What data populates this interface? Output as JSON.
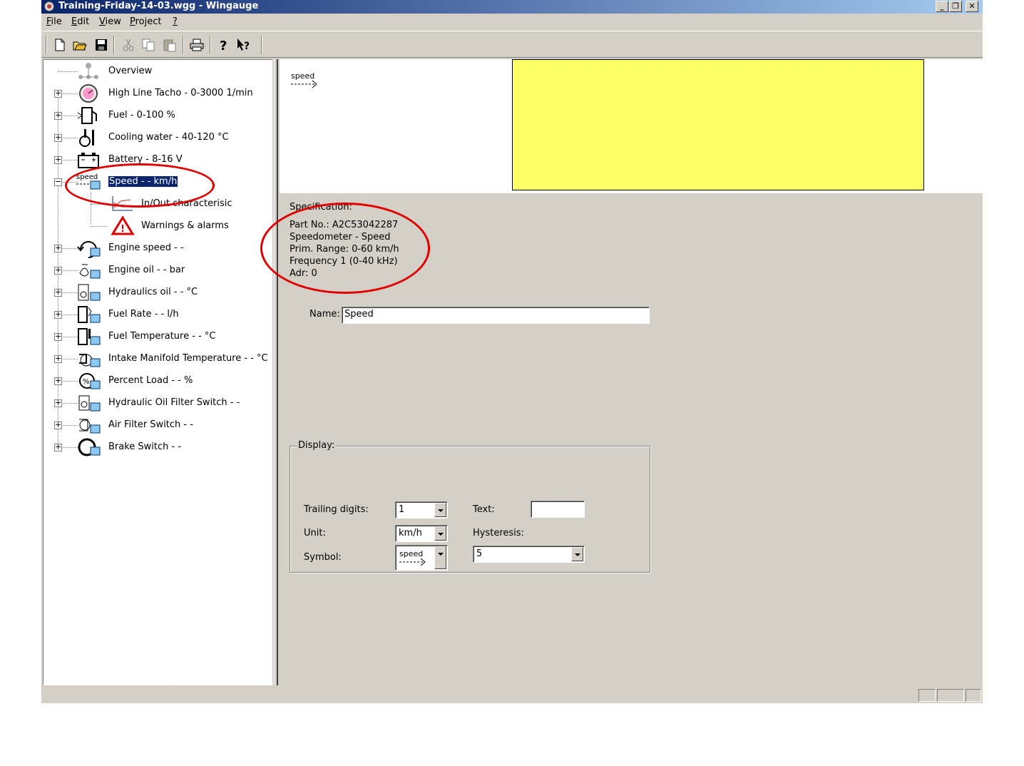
{
  "window": {
    "title": "Training-Friday-14-03.wgg - Wingauge",
    "controls": [
      "_",
      "ʘ",
      "X"
    ]
  },
  "menu": [
    {
      "label": "File"
    },
    {
      "label": "Edit"
    },
    {
      "label": "View"
    },
    {
      "label": "Project"
    },
    {
      "label": "?"
    }
  ],
  "toolbar": {
    "icons": [
      "new-icon",
      "open-icon",
      "save-icon",
      "cut-icon",
      "copy-icon",
      "paste-icon",
      "print-icon",
      "help-icon",
      "context-help-icon"
    ]
  },
  "tree": {
    "items": [
      {
        "label": "Overview",
        "icon": "overview-icon"
      },
      {
        "label": "High Line Tacho - 0-3000 1/min",
        "icon": "tacho-icon"
      },
      {
        "label": "Fuel - 0-100 %",
        "icon": "fuel-icon"
      },
      {
        "label": "Cooling water - 40-120 °C",
        "icon": "thermometer-icon"
      },
      {
        "label": "Battery - 8-16 V",
        "icon": "battery-icon"
      },
      {
        "label": "Speed - - km/h",
        "icon": "speed-icon",
        "selected": true
      },
      {
        "label": "In/Out characterisic",
        "icon": "chart-icon"
      },
      {
        "label": "Warnings & alarms",
        "icon": "warning-icon"
      },
      {
        "label": "Engine speed - -",
        "icon": "engine-speed-icon"
      },
      {
        "label": "Engine oil - - bar",
        "icon": "oil-can-icon"
      },
      {
        "label": "Hydraulics oil - - °C",
        "icon": "hydraulic-oil-icon"
      },
      {
        "label": "Fuel Rate - - l/h",
        "icon": "fuel-rate-icon"
      },
      {
        "label": "Fuel Temperature - - °C",
        "icon": "fuel-temp-icon"
      },
      {
        "label": "Intake Manifold Temperature - - °C",
        "icon": "intake-manifold-icon"
      },
      {
        "label": "Percent Load - - %",
        "icon": "percent-load-icon"
      },
      {
        "label": "Hydraulic Oil Filter Switch - -",
        "icon": "oil-filter-icon"
      },
      {
        "label": "Air Filter Switch - -",
        "icon": "air-filter-icon"
      },
      {
        "label": "Brake Switch - -",
        "icon": "brake-icon"
      }
    ]
  },
  "preview": {
    "symbol_text": "speed",
    "color": "#ffff66"
  },
  "specification": {
    "heading": "Specification:",
    "lines": [
      "Part No.: A2C53042287",
      "Speedometer - Speed",
      "Prim. Range: 0-60 km/h",
      "Frequency 1 (0-40 kHz)",
      "Adr: 0"
    ]
  },
  "name_field": {
    "label": "Name:",
    "value": "Speed"
  },
  "display": {
    "legend": "Display:",
    "trailing_digits_label": "Trailing digits:",
    "trailing_digits_value": "1",
    "unit_label": "Unit:",
    "unit_value": "km/h",
    "symbol_label": "Symbol:",
    "symbol_value": "speed",
    "text_label": "Text:",
    "text_value": "",
    "hysteresis_label": "Hysteresis:",
    "hysteresis_value": "5"
  },
  "annotation_color": "#e00000"
}
